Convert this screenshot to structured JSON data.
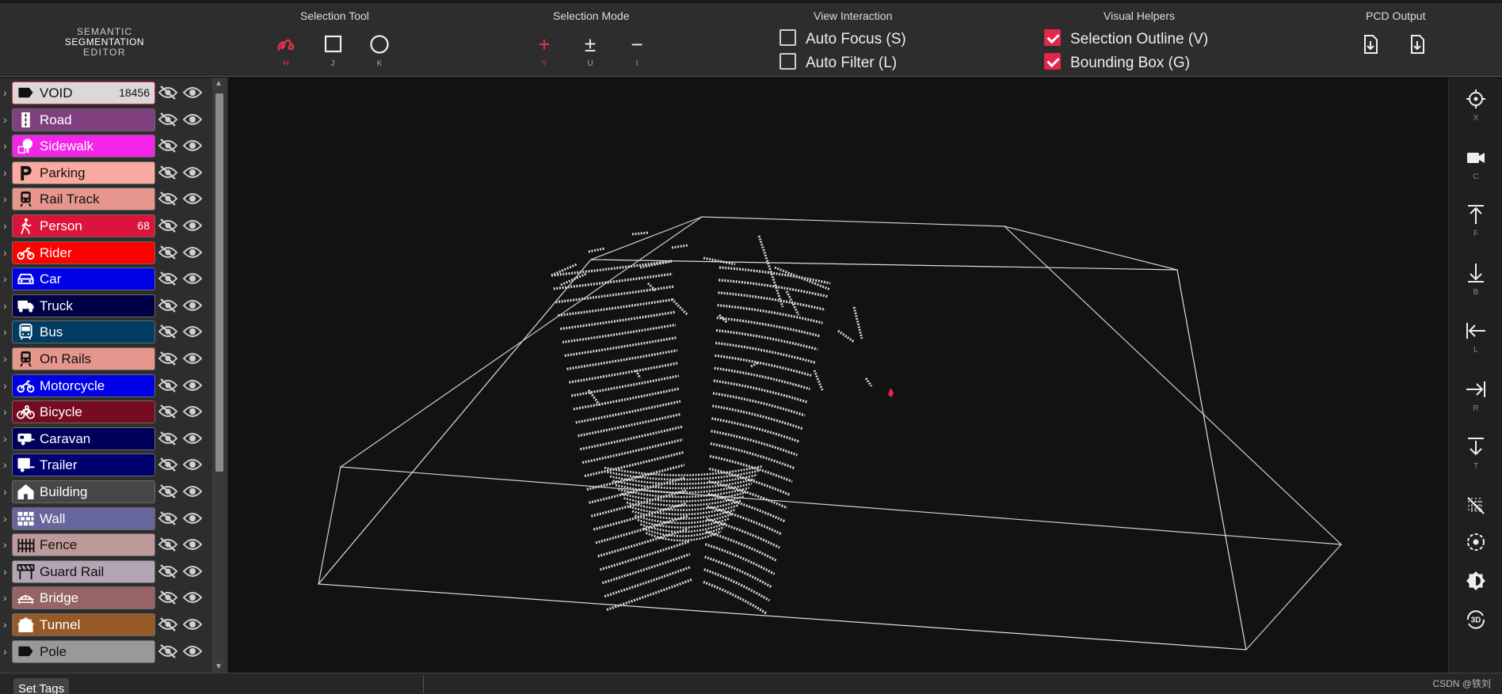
{
  "brand": {
    "line1": "SEMANTIC",
    "line2": "SEGMENTATION",
    "line3": "EDITOR"
  },
  "toolbar": {
    "selection_tool": {
      "title": "Selection Tool",
      "items": [
        {
          "icon": "lasso-icon",
          "key": "H",
          "active": true
        },
        {
          "icon": "square-icon",
          "key": "J",
          "active": false
        },
        {
          "icon": "circle-icon",
          "key": "K",
          "active": false
        }
      ]
    },
    "selection_mode": {
      "title": "Selection Mode",
      "items": [
        {
          "icon": "plus-icon",
          "glyph": "+",
          "key": "Y",
          "active": true
        },
        {
          "icon": "plus-minus-icon",
          "glyph": "±",
          "key": "U",
          "active": false
        },
        {
          "icon": "minus-icon",
          "glyph": "−",
          "key": "I",
          "active": false
        }
      ]
    },
    "view_interaction": {
      "title": "View Interaction",
      "items": [
        {
          "label": "Auto Focus (S)",
          "checked": false
        },
        {
          "label": "Auto Filter (L)",
          "checked": false
        }
      ]
    },
    "visual_helpers": {
      "title": "Visual Helpers",
      "items": [
        {
          "label": "Selection Outline (V)",
          "checked": true
        },
        {
          "label": "Bounding Box (G)",
          "checked": true
        }
      ]
    },
    "pcd_output": {
      "title": "PCD Output",
      "items": [
        {
          "icon": "download-file-icon"
        },
        {
          "icon": "download-file-icon"
        }
      ]
    }
  },
  "labels": [
    {
      "name": "VOID",
      "count": "18456",
      "color": "#d9d9d9",
      "text": "dark",
      "icon": "tag-icon"
    },
    {
      "name": "Road",
      "count": "",
      "color": "#804080",
      "text": "light",
      "icon": "road-icon"
    },
    {
      "name": "Sidewalk",
      "count": "",
      "color": "#f423e8",
      "text": "light",
      "icon": "tree-icon"
    },
    {
      "name": "Parking",
      "count": "",
      "color": "#faaaa0",
      "text": "dark",
      "icon": "parking-icon"
    },
    {
      "name": "Rail Track",
      "count": "",
      "color": "#e6968c",
      "text": "dark",
      "icon": "train-icon"
    },
    {
      "name": "Person",
      "count": "68",
      "color": "#dc143c",
      "text": "light",
      "icon": "walking-icon"
    },
    {
      "name": "Rider",
      "count": "",
      "color": "#ff0000",
      "text": "light",
      "icon": "motorbike-icon"
    },
    {
      "name": "Car",
      "count": "",
      "color": "#0000e6",
      "text": "light",
      "icon": "car-icon"
    },
    {
      "name": "Truck",
      "count": "",
      "color": "#000046",
      "text": "light",
      "icon": "truck-icon"
    },
    {
      "name": "Bus",
      "count": "",
      "color": "#003c64",
      "text": "light",
      "icon": "bus-icon"
    },
    {
      "name": "On Rails",
      "count": "",
      "color": "#e6968c",
      "text": "dark",
      "icon": "train-icon"
    },
    {
      "name": "Motorcycle",
      "count": "",
      "color": "#0000e6",
      "text": "light",
      "icon": "motorbike-icon"
    },
    {
      "name": "Bicycle",
      "count": "",
      "color": "#770b20",
      "text": "light",
      "icon": "bicycle-icon"
    },
    {
      "name": "Caravan",
      "count": "",
      "color": "#00005a",
      "text": "light",
      "icon": "caravan-icon"
    },
    {
      "name": "Trailer",
      "count": "",
      "color": "#00006e",
      "text": "light",
      "icon": "trailer-icon"
    },
    {
      "name": "Building",
      "count": "",
      "color": "#464646",
      "text": "light",
      "icon": "building-icon"
    },
    {
      "name": "Wall",
      "count": "",
      "color": "#66669c",
      "text": "light",
      "icon": "wall-icon"
    },
    {
      "name": "Fence",
      "count": "",
      "color": "#be9999",
      "text": "dark",
      "icon": "fence-icon"
    },
    {
      "name": "Guard Rail",
      "count": "",
      "color": "#b4a5b4",
      "text": "dark",
      "icon": "guardrail-icon"
    },
    {
      "name": "Bridge",
      "count": "",
      "color": "#966464",
      "text": "light",
      "icon": "bridge-icon"
    },
    {
      "name": "Tunnel",
      "count": "",
      "color": "#965a28",
      "text": "light",
      "icon": "tunnel-icon"
    },
    {
      "name": "Pole",
      "count": "",
      "color": "#999999",
      "text": "dark",
      "icon": "tag-icon"
    }
  ],
  "right_toolbar": [
    {
      "icon": "crosshair-icon",
      "key": "X"
    },
    {
      "icon": "camera-icon",
      "key": "C"
    },
    {
      "icon": "view-front-icon",
      "key": "F"
    },
    {
      "icon": "view-back-icon",
      "key": "B"
    },
    {
      "icon": "view-left-icon",
      "key": "L"
    },
    {
      "icon": "view-right-icon",
      "key": "R"
    },
    {
      "icon": "view-top-icon",
      "key": "T"
    },
    {
      "icon": "grid-off-icon",
      "key": ""
    },
    {
      "icon": "center-target-icon",
      "key": ""
    },
    {
      "icon": "brightness-icon",
      "key": ""
    },
    {
      "icon": "rotate-3d-icon",
      "key": ""
    }
  ],
  "bottom": {
    "set_tags": "Set Tags",
    "watermark": "CSDN @铁刘"
  },
  "colors": {
    "accent": "#e3264a",
    "toolbar_bg": "#2d2d2d",
    "viewport_bg": "#121212",
    "point": "#d8d8d8",
    "selected_point": "#e3264a"
  }
}
